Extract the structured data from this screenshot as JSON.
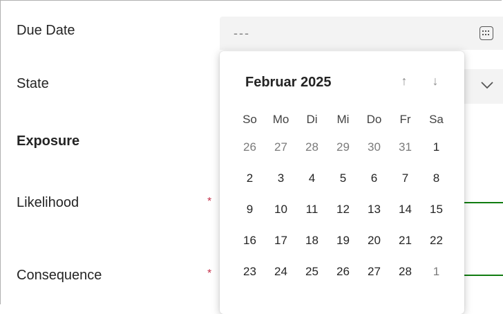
{
  "form": {
    "due_date_label": "Due Date",
    "due_date_value": "---",
    "state_label": "State",
    "exposure_label": "Exposure",
    "likelihood_label": "Likelihood",
    "consequence_label": "Consequence",
    "required_marker": "*"
  },
  "datepicker": {
    "month_title": "Februar 2025",
    "prev_icon": "↑",
    "next_icon": "↓",
    "weekdays": [
      "So",
      "Mo",
      "Di",
      "Mi",
      "Do",
      "Fr",
      "Sa"
    ],
    "weeks": [
      [
        {
          "d": "26",
          "m": true
        },
        {
          "d": "27",
          "m": true
        },
        {
          "d": "28",
          "m": true
        },
        {
          "d": "29",
          "m": true
        },
        {
          "d": "30",
          "m": true
        },
        {
          "d": "31",
          "m": true
        },
        {
          "d": "1",
          "m": false
        }
      ],
      [
        {
          "d": "2",
          "m": false
        },
        {
          "d": "3",
          "m": false
        },
        {
          "d": "4",
          "m": false
        },
        {
          "d": "5",
          "m": false
        },
        {
          "d": "6",
          "m": false
        },
        {
          "d": "7",
          "m": false
        },
        {
          "d": "8",
          "m": false
        }
      ],
      [
        {
          "d": "9",
          "m": false
        },
        {
          "d": "10",
          "m": false
        },
        {
          "d": "11",
          "m": false
        },
        {
          "d": "12",
          "m": false
        },
        {
          "d": "13",
          "m": false
        },
        {
          "d": "14",
          "m": false
        },
        {
          "d": "15",
          "m": false
        }
      ],
      [
        {
          "d": "16",
          "m": false
        },
        {
          "d": "17",
          "m": false
        },
        {
          "d": "18",
          "m": false
        },
        {
          "d": "19",
          "m": false
        },
        {
          "d": "20",
          "m": false
        },
        {
          "d": "21",
          "m": false
        },
        {
          "d": "22",
          "m": false
        }
      ],
      [
        {
          "d": "23",
          "m": false
        },
        {
          "d": "24",
          "m": false
        },
        {
          "d": "25",
          "m": false
        },
        {
          "d": "26",
          "m": false
        },
        {
          "d": "27",
          "m": false
        },
        {
          "d": "28",
          "m": false
        },
        {
          "d": "1",
          "m": true
        }
      ]
    ]
  },
  "colors": {
    "accent_green": "#107c10",
    "required_red": "#c4314b"
  }
}
